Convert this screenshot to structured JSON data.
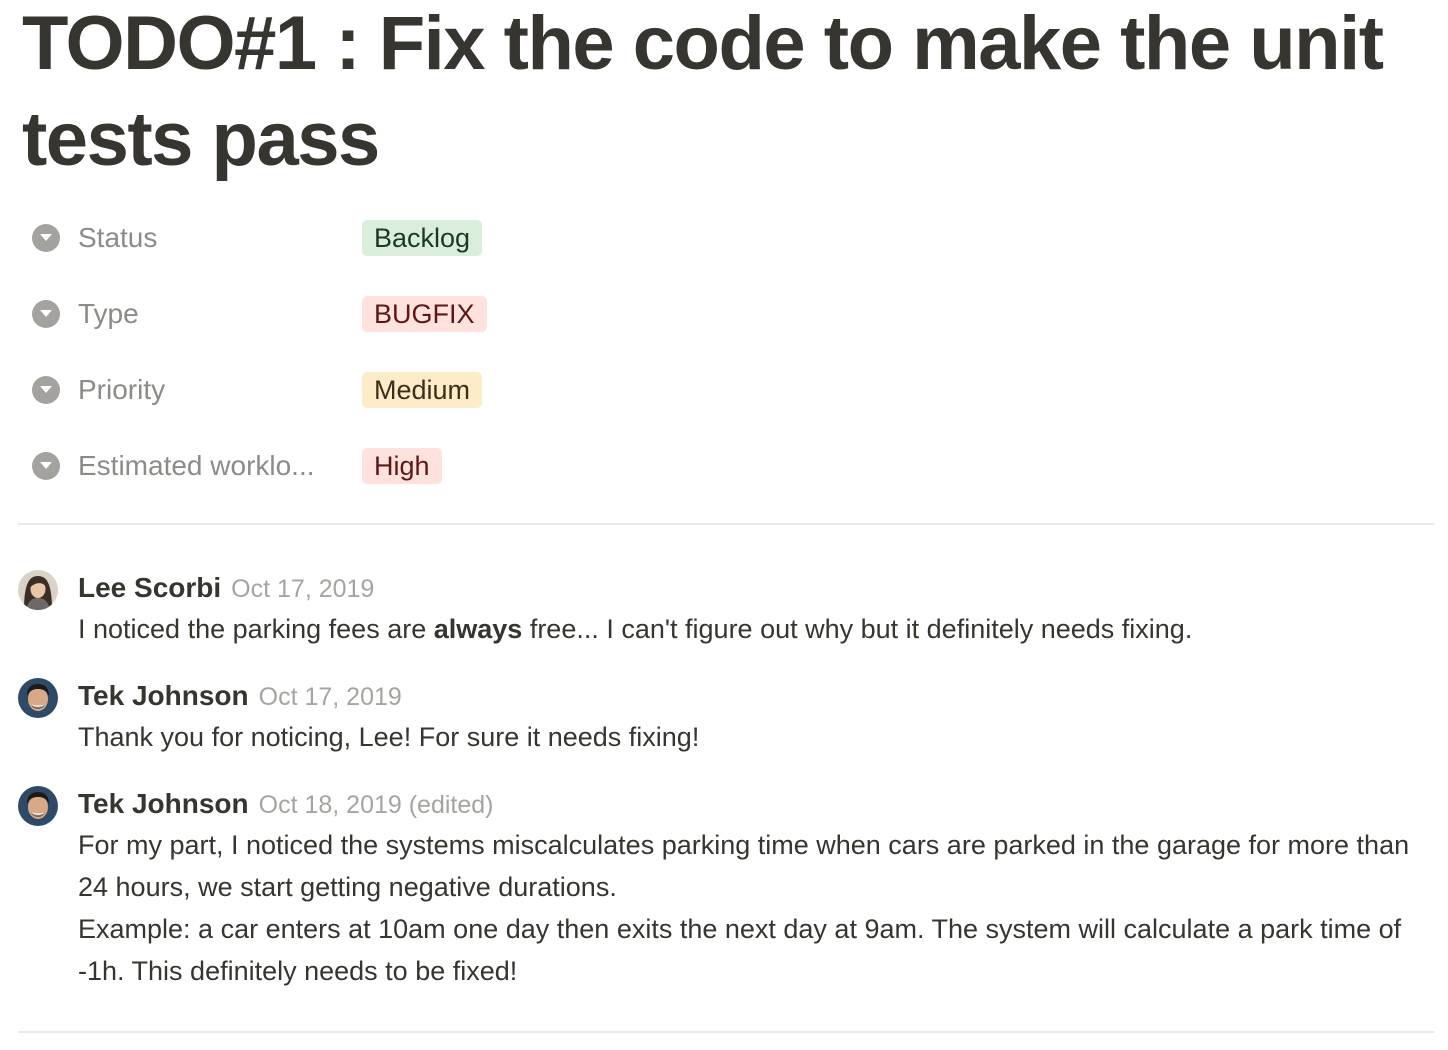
{
  "page": {
    "title": "TODO#1 : Fix the code to make the unit tests pass"
  },
  "properties": [
    {
      "label": "Status",
      "value": "Backlog",
      "tag_color": "#dbeddb",
      "text_color": "#1c3829",
      "icon": "chevron-down-circle-icon"
    },
    {
      "label": "Type",
      "value": "BUGFIX",
      "tag_color": "#ffe2dd",
      "text_color": "#5d1715",
      "icon": "chevron-down-circle-icon"
    },
    {
      "label": "Priority",
      "value": "Medium",
      "tag_color": "#fdecc8",
      "text_color": "#402c1b",
      "icon": "chevron-down-circle-icon"
    },
    {
      "label": "Estimated worklo...",
      "value": "High",
      "tag_color": "#ffe2dd",
      "text_color": "#5d1715",
      "icon": "chevron-down-circle-icon"
    }
  ],
  "comments": [
    {
      "author": "Lee Scorbi",
      "date": "Oct 17, 2019",
      "avatar": "avatar-icon",
      "body_pre": "I noticed the parking fees are ",
      "body_bold": "always",
      "body_post": " free... I can't figure out why but it definitely needs fixing."
    },
    {
      "author": "Tek Johnson",
      "date": "Oct 17, 2019",
      "avatar": "avatar-icon",
      "body": "Thank you for noticing, Lee! For sure it needs fixing!"
    },
    {
      "author": "Tek Johnson",
      "date": "Oct 18, 2019 (edited)",
      "avatar": "avatar-icon",
      "body_line1": "For my part, I noticed the systems miscalculates parking time when cars are parked in the garage for more than 24 hours, we start getting negative durations.",
      "body_line2": "Example: a car enters at 10am one day then exits the next day at 9am. The system will calculate a park time of -1h. This definitely needs to be fixed!"
    }
  ],
  "colors": {
    "text": "#37352f",
    "muted": "#8d8b87",
    "date": "#a6a4a0",
    "divider": "#e9e9e7"
  }
}
